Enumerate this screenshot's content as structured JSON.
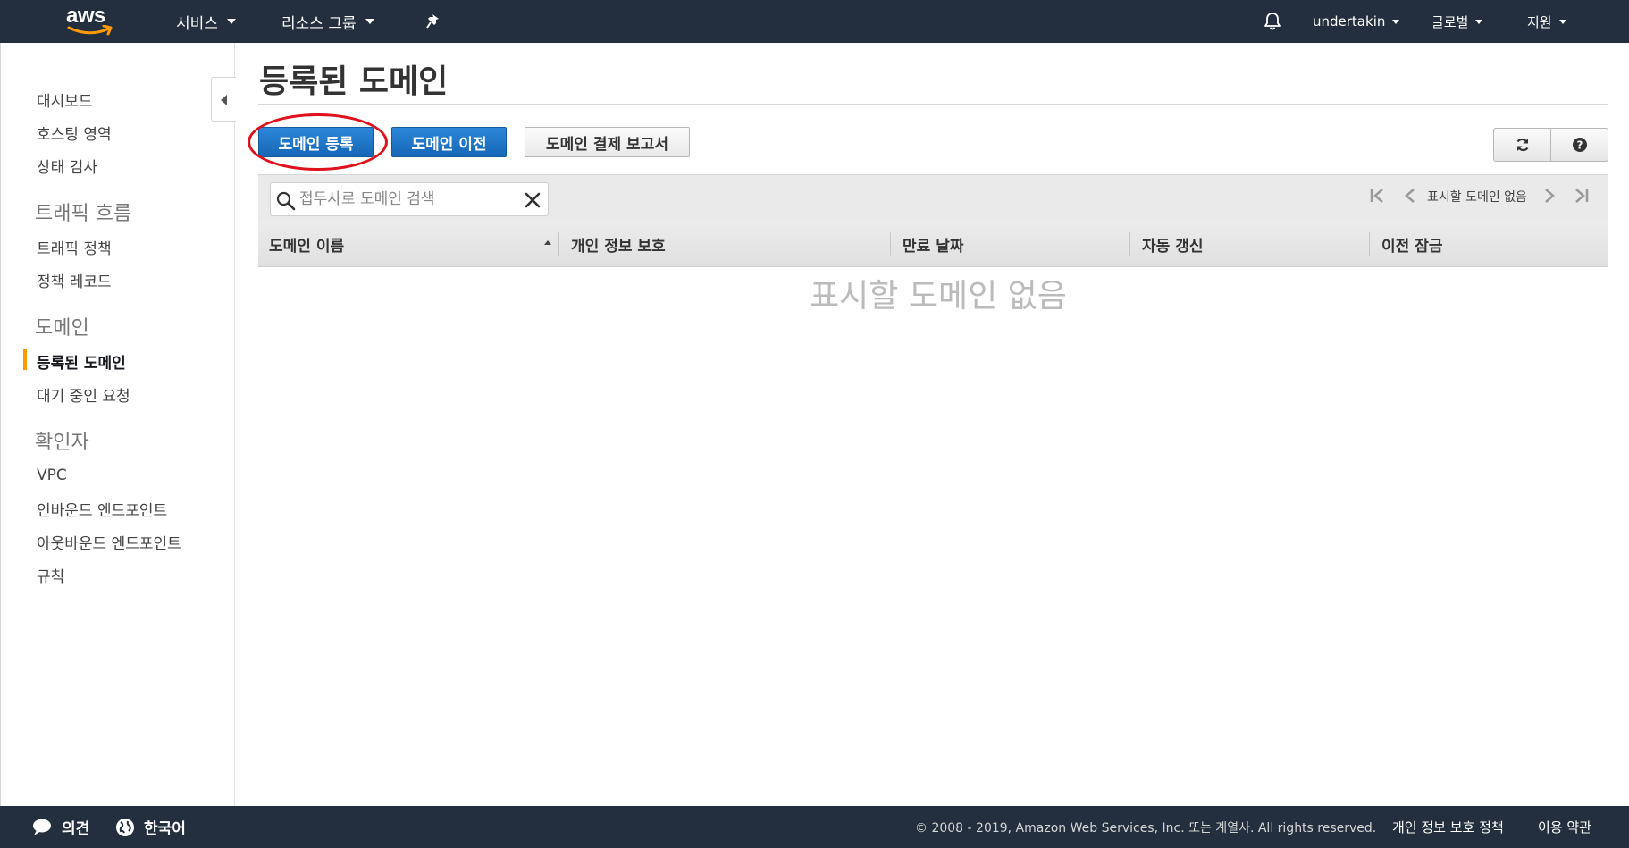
{
  "topnav": {
    "logo": "aws",
    "services": "서비스",
    "resource_groups": "리소스 그룹",
    "pin_icon": "pin-icon",
    "bell_icon": "bell-icon",
    "user": "undertakin",
    "region": "글로벌",
    "support": "지원"
  },
  "sidebar": {
    "dashboard": "대시보드",
    "hosted_zones": "호스팅 영역",
    "health_checks": "상태 검사",
    "traffic_flow_heading": "트래픽 흐름",
    "traffic_policies": "트래픽 정책",
    "policy_records": "정책 레코드",
    "domains_heading": "도메인",
    "registered_domains": "등록된 도메인",
    "pending_requests": "대기 중인 요청",
    "resolver_heading": "확인자",
    "vpc": "VPC",
    "inbound_endpoints": "인바운드 엔드포인트",
    "outbound_endpoints": "아웃바운드 엔드포인트",
    "rules": "규칙"
  },
  "main": {
    "title": "등록된 도메인",
    "register_button": "도메인 등록",
    "transfer_button": "도메인 이전",
    "billing_report_button": "도메인 결제 보고서",
    "refresh_icon": "refresh-icon",
    "help_icon": "help-icon",
    "search_placeholder": "접두사로 도메인 검색",
    "pager_text": "표시할 도메인 없음",
    "columns": [
      "도메인 이름",
      "개인 정보 보호",
      "만료 날짜",
      "자동 갱신",
      "이전 잠금"
    ],
    "empty_message": "표시할 도메인 없음"
  },
  "footer": {
    "feedback": "의견",
    "language": "한국어",
    "copyright": "© 2008 - 2019, Amazon Web Services, Inc. 또는 계열사. All rights reserved.",
    "privacy": "개인 정보 보호 정책",
    "terms": "이용 약관"
  },
  "colors": {
    "nav_bg": "#232f3e",
    "primary_button": "#1b75c9",
    "active_accent": "#ff9900",
    "highlight_ellipse": "#e0101c"
  }
}
